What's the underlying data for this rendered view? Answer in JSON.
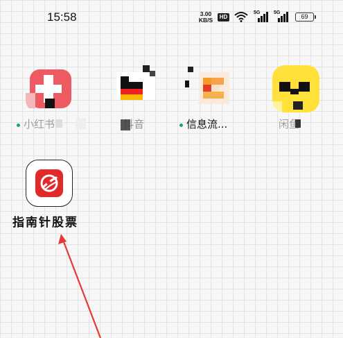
{
  "status_bar": {
    "time": "15:58",
    "net_speed_value": "3.00",
    "net_speed_unit": "KB/S",
    "hd_badge": "HD",
    "sim1_label": "5G",
    "sim2_label": "5G",
    "battery_level": "69"
  },
  "apps": [
    {
      "label": "小红书",
      "notification_dot": true
    },
    {
      "label": "抖音",
      "notification_dot": false
    },
    {
      "label": "信息流...",
      "notification_dot": true
    },
    {
      "label": "闲鱼",
      "notification_dot": false
    }
  ],
  "highlight_app": {
    "label": "指南针股票"
  },
  "colors": {
    "zhinan_brand": "#e02a2a",
    "arrow": "#e53935",
    "notification_dot": "#1aa66a"
  }
}
